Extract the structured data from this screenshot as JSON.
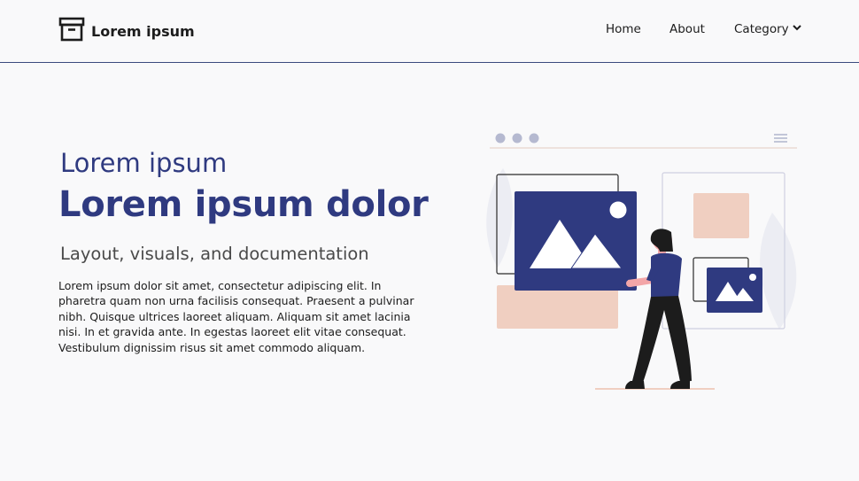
{
  "header": {
    "logo_text": "Lorem ipsum",
    "nav": {
      "home": "Home",
      "about": "About",
      "category": "Category"
    }
  },
  "hero": {
    "kicker": "Lorem ipsum",
    "title": "Lorem ipsum dolor",
    "subtitle": "Layout, visuals, and documentation",
    "body": "Lorem ipsum dolor sit amet, consectetur adipiscing elit. In pharetra quam non urna facilisis consequat. Praesent a pulvinar nibh. Quisque ultrices laoreet aliquam. Aliquam sit amet lacinia nisi. In et gravida ante. In egestas laoreet elit vitae consequat. Vestibulum dignissim risus sit amet commodo aliquam."
  },
  "icons": {
    "logo": "archive-box-icon",
    "category_caret": "chevron-down-icon",
    "illustration": "person-with-image-gallery-illustration"
  },
  "colors": {
    "accent": "#2f3a80",
    "text": "#1c1c1c",
    "muted": "#4a4a4a",
    "background": "#f9f9fa",
    "peach": "#f0cfc1"
  }
}
